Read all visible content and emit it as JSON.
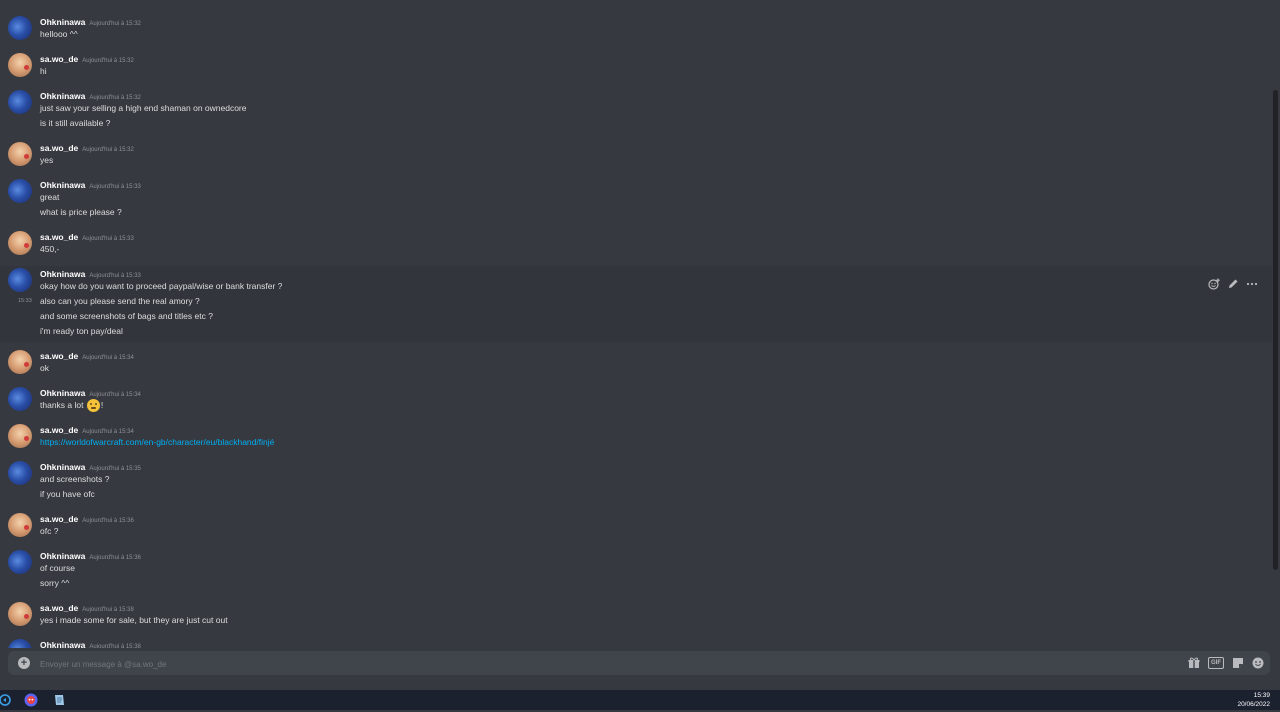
{
  "messages": [
    {
      "author": "Ohkninawa",
      "avatar": "ohkninawa",
      "time": "Aujourd'hui à 15:32",
      "lines": [
        "hellooo ^^"
      ]
    },
    {
      "author": "sa.wo_de",
      "avatar": "sawo",
      "time": "Aujourd'hui à 15:32",
      "lines": [
        "hi"
      ]
    },
    {
      "author": "Ohkninawa",
      "avatar": "ohkninawa",
      "time": "Aujourd'hui à 15:32",
      "lines": [
        "just saw your selling a high end shaman on ownedcore",
        "is it still available ?"
      ]
    },
    {
      "author": "sa.wo_de",
      "avatar": "sawo",
      "time": "Aujourd'hui à 15:32",
      "lines": [
        "yes"
      ]
    },
    {
      "author": "Ohkninawa",
      "avatar": "ohkninawa",
      "time": "Aujourd'hui à 15:33",
      "lines": [
        "great",
        "what is price please ?"
      ]
    },
    {
      "author": "sa.wo_de",
      "avatar": "sawo",
      "time": "Aujourd'hui à 15:33",
      "lines": [
        "450,-"
      ]
    },
    {
      "author": "Ohkninawa",
      "avatar": "ohkninawa",
      "time": "Aujourd'hui à 15:33",
      "lines": [
        "okay how do you want to proceed paypal/wise or bank transfer ?",
        "also can you please send the real amory ?",
        "and some screenshots of bags and titles etc ?",
        "i'm ready ton pay/deal"
      ],
      "hover_time": "15:33"
    },
    {
      "author": "sa.wo_de",
      "avatar": "sawo",
      "time": "Aujourd'hui à 15:34",
      "lines": [
        "ok"
      ]
    },
    {
      "author": "Ohkninawa",
      "avatar": "ohkninawa",
      "time": "Aujourd'hui à 15:34",
      "lines": [
        "thanks a lot"
      ],
      "emoji_suffix": "!"
    },
    {
      "author": "sa.wo_de",
      "avatar": "sawo",
      "time": "Aujourd'hui à 15:34",
      "lines": [
        "https://worldofwarcraft.com/en-gb/character/eu/blackhand/finjé"
      ],
      "link": true
    },
    {
      "author": "Ohkninawa",
      "avatar": "ohkninawa",
      "time": "Aujourd'hui à 15:35",
      "lines": [
        "and screenshots ?",
        "if you have ofc"
      ]
    },
    {
      "author": "sa.wo_de",
      "avatar": "sawo",
      "time": "Aujourd'hui à 15:36",
      "lines": [
        "ofc ?"
      ]
    },
    {
      "author": "Ohkninawa",
      "avatar": "ohkninawa",
      "time": "Aujourd'hui à 15:36",
      "lines": [
        "of course",
        "sorry ^^"
      ]
    },
    {
      "author": "sa.wo_de",
      "avatar": "sawo",
      "time": "Aujourd'hui à 15:38",
      "lines": [
        "yes i made some for sale, but they are just cut out"
      ]
    },
    {
      "author": "Ohkninawa",
      "avatar": "ohkninawa",
      "time": "Aujourd'hui à 15:38",
      "lines": []
    }
  ],
  "composer": {
    "placeholder": "Envoyer un message à @sa.wo_de"
  },
  "message_actions": [
    "add-reaction-icon",
    "edit-icon",
    "more-icon"
  ],
  "composer_icons": [
    "gift-icon",
    "gif-button",
    "sticker-icon",
    "emoji-icon"
  ],
  "gif_label": "GIF",
  "taskbar": {
    "time": "15:39",
    "date": "20/06/2022"
  },
  "colors": {
    "background": "#36393f",
    "link": "#00aff4",
    "composer": "#40444b",
    "taskbar": "#1c2130"
  }
}
